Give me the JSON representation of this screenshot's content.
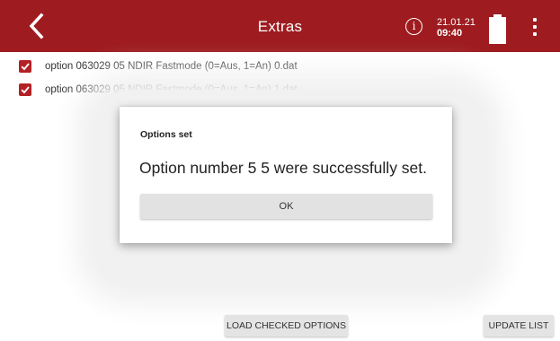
{
  "header": {
    "title": "Extras",
    "back_icon": "chevron-left-icon",
    "info_icon": "info-icon",
    "info_glyph": "i",
    "date": "21.01.21",
    "time": "09:40",
    "battery_icon": "battery-icon",
    "battery_level": 1.0,
    "menu_icon": "more-vert-icon",
    "background_color": "#9e1c20"
  },
  "options": {
    "items": [
      {
        "label": "option 063029 05 NDIR Fastmode (0=Aus, 1=An) 0.dat",
        "checked": true
      },
      {
        "label": "option 063029 05 NDIR Fastmode (0=Aus, 1=An) 1.dat",
        "checked": true
      }
    ],
    "checkbox_color": "#b32025"
  },
  "dialog": {
    "title": "Options set",
    "message": "Option number 5 5 were successfully set.",
    "ok_label": "OK"
  },
  "footer": {
    "load_label": "LOAD CHECKED OPTIONS",
    "update_label": "UPDATE LIST"
  }
}
